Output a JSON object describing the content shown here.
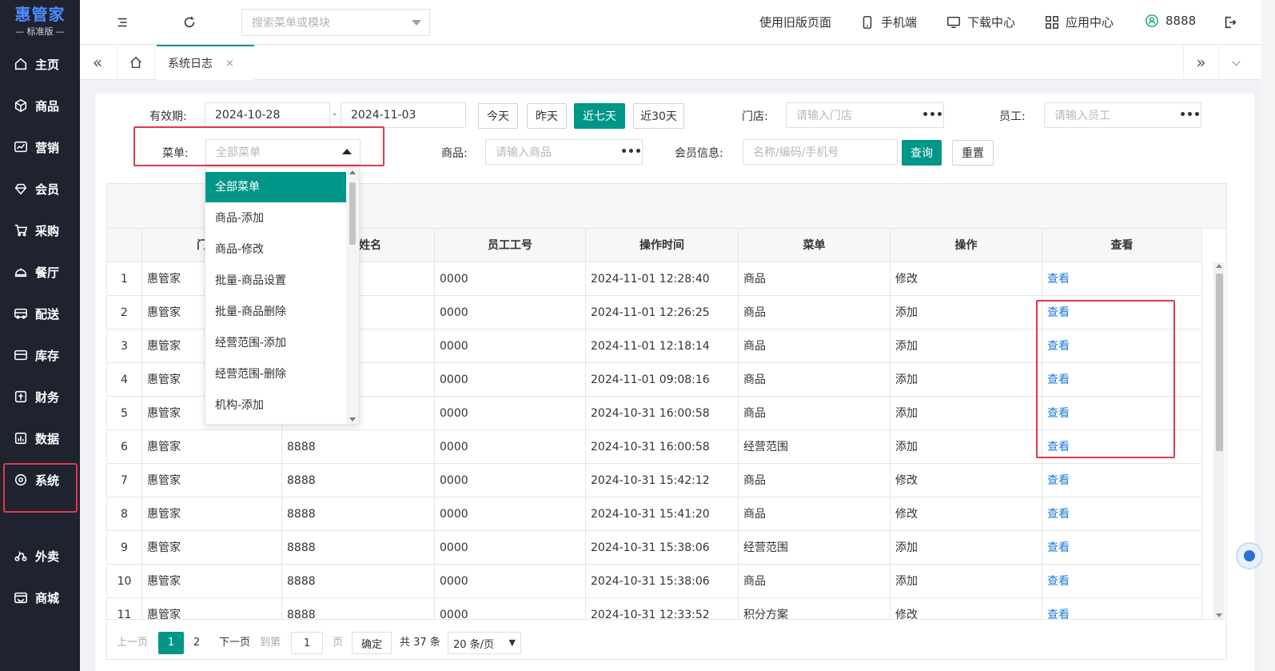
{
  "brand": {
    "title": "惠管家",
    "subtitle": "标准版"
  },
  "sidebar": {
    "items": [
      {
        "label": "主页",
        "icon": "home-icon"
      },
      {
        "label": "商品",
        "icon": "box-icon"
      },
      {
        "label": "营销",
        "icon": "chart-icon"
      },
      {
        "label": "会员",
        "icon": "diamond-icon"
      },
      {
        "label": "采购",
        "icon": "cart-icon"
      },
      {
        "label": "餐厅",
        "icon": "cloche-icon"
      },
      {
        "label": "配送",
        "icon": "truck-icon"
      },
      {
        "label": "库存",
        "icon": "inventory-icon"
      },
      {
        "label": "财务",
        "icon": "finance-icon"
      },
      {
        "label": "数据",
        "icon": "data-icon"
      },
      {
        "label": "系统",
        "icon": "settings-icon"
      },
      {
        "label": "外卖",
        "icon": "delivery-icon"
      },
      {
        "label": "商城",
        "icon": "shop-icon"
      }
    ],
    "active": "系统"
  },
  "topbar": {
    "search_placeholder": "搜索菜单或模块",
    "old_version": "使用旧版页面",
    "mobile": "手机端",
    "downloads": "下载中心",
    "apps": "应用中心",
    "user": "8888"
  },
  "tabs": {
    "active_label": "系统日志",
    "close": "×"
  },
  "filters": {
    "valid_label": "有效期:",
    "date_from": "2024-10-28",
    "date_sep": "-",
    "date_to": "2024-11-03",
    "quick": [
      "今天",
      "昨天",
      "近七天",
      "近30天"
    ],
    "quick_active": "近七天",
    "store_label": "门店:",
    "store_placeholder": "请输入门店",
    "employee_label": "员工:",
    "employee_placeholder": "请输入员工",
    "menu_label": "菜单:",
    "menu_value": "全部菜单",
    "goods_label": "商品:",
    "goods_placeholder": "请输入商品",
    "member_label": "会员信息:",
    "member_placeholder": "名称/编码/手机号",
    "query": "查询",
    "reset": "重置",
    "dots": "•••"
  },
  "dropdown": {
    "options": [
      "全部菜单",
      "商品-添加",
      "商品-修改",
      "批量-商品设置",
      "批量-商品删除",
      "经营范围-添加",
      "经营范围-删除",
      "机构-添加"
    ],
    "selected": "全部菜单"
  },
  "table": {
    "columns": [
      "",
      "门",
      "姓名",
      "员工工号",
      "操作时间",
      "菜单",
      "操作",
      "查看"
    ],
    "rows": [
      [
        "1",
        "惠管家",
        "",
        "0000",
        "2024-11-01 12:28:40",
        "商品",
        "修改",
        "查看"
      ],
      [
        "2",
        "惠管家",
        "",
        "0000",
        "2024-11-01 12:26:25",
        "商品",
        "添加",
        "查看"
      ],
      [
        "3",
        "惠管家",
        "",
        "0000",
        "2024-11-01 12:18:14",
        "商品",
        "添加",
        "查看"
      ],
      [
        "4",
        "惠管家",
        "",
        "0000",
        "2024-11-01 09:08:16",
        "商品",
        "添加",
        "查看"
      ],
      [
        "5",
        "惠管家",
        "",
        "0000",
        "2024-10-31 16:00:58",
        "商品",
        "添加",
        "查看"
      ],
      [
        "6",
        "惠管家",
        "8888",
        "0000",
        "2024-10-31 16:00:58",
        "经营范围",
        "添加",
        "查看"
      ],
      [
        "7",
        "惠管家",
        "8888",
        "0000",
        "2024-10-31 15:42:12",
        "商品",
        "修改",
        "查看"
      ],
      [
        "8",
        "惠管家",
        "8888",
        "0000",
        "2024-10-31 15:41:20",
        "商品",
        "修改",
        "查看"
      ],
      [
        "9",
        "惠管家",
        "8888",
        "0000",
        "2024-10-31 15:38:06",
        "经营范围",
        "添加",
        "查看"
      ],
      [
        "10",
        "惠管家",
        "8888",
        "0000",
        "2024-10-31 15:38:06",
        "商品",
        "添加",
        "查看"
      ],
      [
        "11",
        "惠管家",
        "8888",
        "0000",
        "2024-10-31 12:33:52",
        "积分方案",
        "修改",
        "查看"
      ]
    ]
  },
  "pager": {
    "prev": "上一页",
    "pages": [
      "1",
      "2"
    ],
    "current": "1",
    "next": "下一页",
    "goto": "到第",
    "goto_value": "1",
    "page_unit": "页",
    "confirm": "确定",
    "total": "共 37 条",
    "page_size": "20 条/页"
  },
  "colors": {
    "sidebar_bg": "#1f2330",
    "primary": "#009688",
    "link": "#1e7bd9",
    "highlight": "#e0384e"
  }
}
